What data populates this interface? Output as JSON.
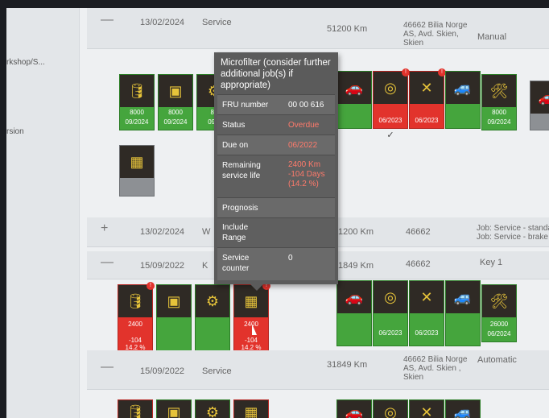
{
  "sidebar": {
    "item1": "rkshop/S...",
    "item2": "rsion"
  },
  "rows": [
    {
      "date": "13/02/2024",
      "type": "Service",
      "km": "51200 Km",
      "dealer": "46662 Bilia Norge AS, Avd. Skien, Skien",
      "note": "Manual"
    },
    {
      "date": "13/02/2024",
      "type": "W",
      "km": "1200 Km",
      "dealer": "46662",
      "note": "Job: Service - standa\nJob: Service - brake f"
    },
    {
      "date": "15/09/2022",
      "type": "K",
      "km": "1849 Km",
      "dealer": "46662",
      "note": "Key 1"
    },
    {
      "date": "15/09/2022",
      "type": "Service",
      "km": "31849 Km",
      "dealer": "46662 Bilia Norge AS, Avd. Skien , Skien",
      "note": "Automatic"
    }
  ],
  "toggles": {
    "minus": "—",
    "plus": "+"
  },
  "tiles_top": [
    {
      "km": "8000",
      "date": "09/2024"
    },
    {
      "km": "8000",
      "date": "09/2024"
    },
    {
      "km": "80",
      "date": "09/2"
    },
    {
      "date": "06/2023"
    },
    {
      "date": "06/2023"
    },
    {
      "km": "8000",
      "date": "09/2024"
    },
    {
      "check": "✓"
    }
  ],
  "tiles_bottom": [
    {
      "km": "2400",
      "days": "-104",
      "pct": "14.2 %"
    },
    {
      "km": "2400",
      "days": "-104",
      "pct": "14.2 %"
    },
    {
      "date": "06/2023"
    },
    {
      "date": "06/2023"
    },
    {
      "km": "26000",
      "date": "06/2024"
    }
  ],
  "tooltip": {
    "title": "Microfilter (consider further additional job(s) if appropriate)",
    "fru_label": "FRU number",
    "fru_value": "00 00 616",
    "status_label": "Status",
    "status_value": "Overdue",
    "due_label": "Due on",
    "due_value": "06/2022",
    "remaining_label": "Remaining service life",
    "remaining_value": "2400 Km\n-104 Days\n(14.2 %)",
    "prognosis_label": "Prognosis",
    "range_label": "Include Range",
    "counter_label": "Service counter",
    "counter_value": "0"
  },
  "icons": {
    "oil": "oil-can-icon",
    "battery": "battery-icon",
    "filter": "microfilter-icon",
    "wrench": "wrench-icon",
    "brake": "brake-disc-icon",
    "car": "car-lift-icon"
  },
  "colors": {
    "ok": "#45a53d",
    "overdue": "#e2332c",
    "tooltip": "#5b5b5b",
    "tile_header": "#2f2a25"
  }
}
